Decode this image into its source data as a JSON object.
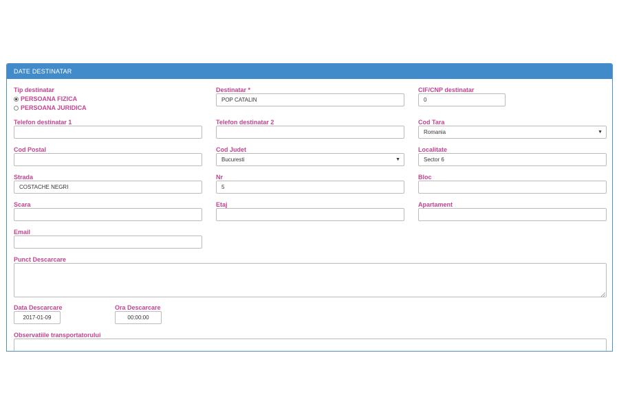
{
  "panel": {
    "title": "DATE DESTINATAR"
  },
  "tip_destinatar": {
    "label": "Tip destinatar",
    "options": [
      "PERSOANA FIZICA",
      "PERSOANA JURIDICA"
    ],
    "selected": "PERSOANA FIZICA"
  },
  "destinatar": {
    "label": "Destinatar *",
    "value": "POP CATALIN"
  },
  "cif_cnp": {
    "label": "CIF/CNP destinatar",
    "value": "0"
  },
  "telefon1": {
    "label": "Telefon destinatar 1",
    "value": ""
  },
  "telefon2": {
    "label": "Telefon destinatar 2",
    "value": ""
  },
  "cod_tara": {
    "label": "Cod Tara",
    "value": "Romania"
  },
  "cod_postal": {
    "label": "Cod Postal",
    "value": ""
  },
  "cod_judet": {
    "label": "Cod Judet",
    "value": "Bucuresti"
  },
  "localitate": {
    "label": "Localitate",
    "value": "Sector 6"
  },
  "strada": {
    "label": "Strada",
    "value": "COSTACHE NEGRI"
  },
  "nr": {
    "label": "Nr",
    "value": "5"
  },
  "bloc": {
    "label": "Bloc",
    "value": ""
  },
  "scara": {
    "label": "Scara",
    "value": ""
  },
  "etaj": {
    "label": "Etaj",
    "value": ""
  },
  "apartament": {
    "label": "Apartament",
    "value": ""
  },
  "email": {
    "label": "Email",
    "value": ""
  },
  "punct_descarcare": {
    "label": "Punct Descarcare",
    "value": ""
  },
  "data_descarcare": {
    "label": "Data Descarcare",
    "value": "2017-01-09"
  },
  "ora_descarcare": {
    "label": "Ora Descarcare",
    "value": "00:00:00"
  },
  "observatii": {
    "label": "Observatiile transportatorului",
    "value": ""
  },
  "icons": {
    "dropdown": "dropdown-arrow-icon",
    "resize": "resize-handle-icon",
    "radio": "radio-icon"
  },
  "colors": {
    "header_bg": "#428bca",
    "label": "#c6438f",
    "border": "#bbbbbb"
  }
}
